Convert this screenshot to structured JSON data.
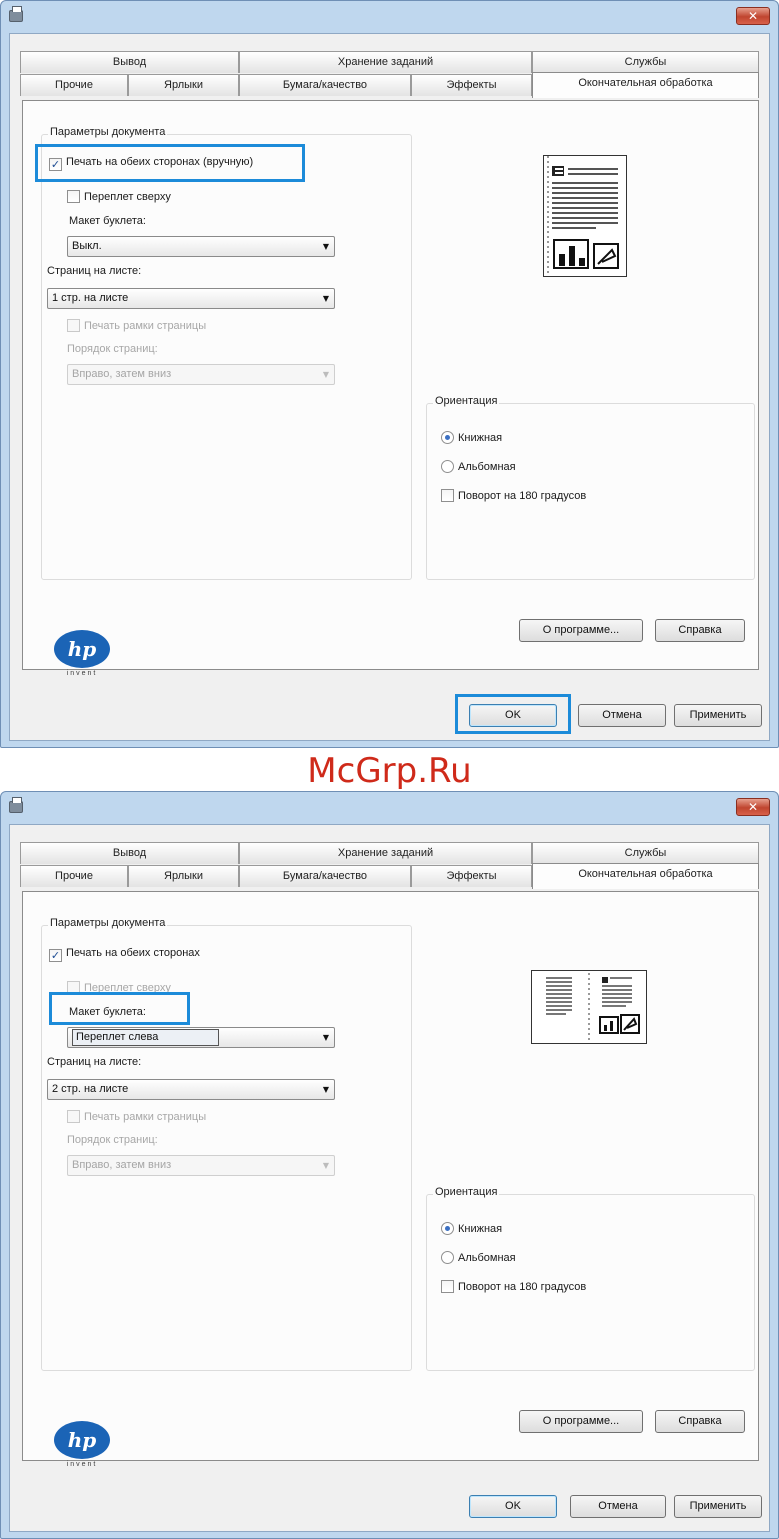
{
  "watermark": "McGrp.Ru",
  "close_glyph": "✕",
  "icons": {
    "printer": "printer-icon",
    "close": "close-icon",
    "dropdown": "chevron-down-icon",
    "check": "checkmark-icon",
    "preview": "page-preview-icon",
    "logo": "hp-logo"
  },
  "colors": {
    "highlight": "#1c8bd9",
    "frame": "#bfd7ee",
    "watermark": "#cf2a1a",
    "logo": "#1b64b6"
  },
  "tabs_top": [
    "Вывод",
    "Хранение заданий",
    "Службы"
  ],
  "tabs_bottom": [
    "Прочие",
    "Ярлыки",
    "Бумага/качество",
    "Эффекты",
    "Окончательная обработка"
  ],
  "dialogs": [
    {
      "doc_group_label": "Параметры документа",
      "print_both_sides": "Печать на обеих сторонах (вручную)",
      "binding_top": "Переплет сверху",
      "booklet_label": "Макет буклета:",
      "booklet_value": "Выкл.",
      "pages_per_sheet_label": "Страниц на листе:",
      "pages_per_sheet_value": "1 стр. на листе",
      "print_borders": "Печать рамки страницы",
      "page_order_label": "Порядок страниц:",
      "page_order_value": "Вправо, затем вниз",
      "orientation_label": "Ориентация",
      "portrait": "Книжная",
      "landscape": "Альбомная",
      "rotate_180": "Поворот на 180 градусов",
      "about_btn": "О программе...",
      "help_btn": "Справка",
      "ok_btn": "OK",
      "cancel_btn": "Отмена",
      "apply_btn": "Применить",
      "hp_logo_text": "hp",
      "hp_invent": "invent",
      "state": {
        "print_both_sides_checked": true,
        "binding_top_checked": false,
        "portrait_selected": true
      }
    },
    {
      "doc_group_label": "Параметры документа",
      "print_both_sides": "Печать на обеих сторонах",
      "binding_top": "Переплет сверху",
      "booklet_label": "Макет буклета:",
      "booklet_value": "Переплет слева",
      "pages_per_sheet_label": "Страниц на листе:",
      "pages_per_sheet_value": "2 стр. на листе",
      "print_borders": "Печать рамки страницы",
      "page_order_label": "Порядок страниц:",
      "page_order_value": "Вправо, затем вниз",
      "orientation_label": "Ориентация",
      "portrait": "Книжная",
      "landscape": "Альбомная",
      "rotate_180": "Поворот на 180 градусов",
      "about_btn": "О программе...",
      "help_btn": "Справка",
      "ok_btn": "OK",
      "cancel_btn": "Отмена",
      "apply_btn": "Применить",
      "hp_logo_text": "hp",
      "hp_invent": "invent",
      "state": {
        "print_both_sides_checked": true,
        "binding_top_checked": false,
        "portrait_selected": true
      }
    }
  ]
}
